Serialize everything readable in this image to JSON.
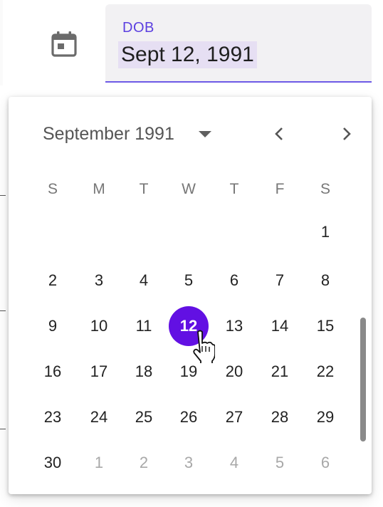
{
  "field": {
    "label": "DOB",
    "value": "Sept 12, 1991"
  },
  "picker": {
    "month_label": "September 1991",
    "weekdays": [
      "S",
      "M",
      "T",
      "W",
      "T",
      "F",
      "S"
    ],
    "selected_day": "12",
    "weeks": [
      [
        "",
        "",
        "",
        "",
        "",
        "",
        "1"
      ],
      [
        "2",
        "3",
        "4",
        "5",
        "6",
        "7",
        "8"
      ],
      [
        "9",
        "10",
        "11",
        "12",
        "13",
        "14",
        "15"
      ],
      [
        "16",
        "17",
        "18",
        "19",
        "20",
        "21",
        "22"
      ],
      [
        "23",
        "24",
        "25",
        "26",
        "27",
        "28",
        "29"
      ],
      [
        "30",
        "1",
        "2",
        "3",
        "4",
        "5",
        "6"
      ]
    ],
    "trailing_other_month_from": 1
  },
  "colors": {
    "accent": "#6210e3",
    "label": "#5b3fe0",
    "underline": "#6d5ae6"
  },
  "icons": {
    "calendar": "calendar-icon",
    "dropdown": "caret-down-icon",
    "prev": "chevron-left-icon",
    "next": "chevron-right-icon",
    "cursor": "hand-pointer-icon"
  }
}
